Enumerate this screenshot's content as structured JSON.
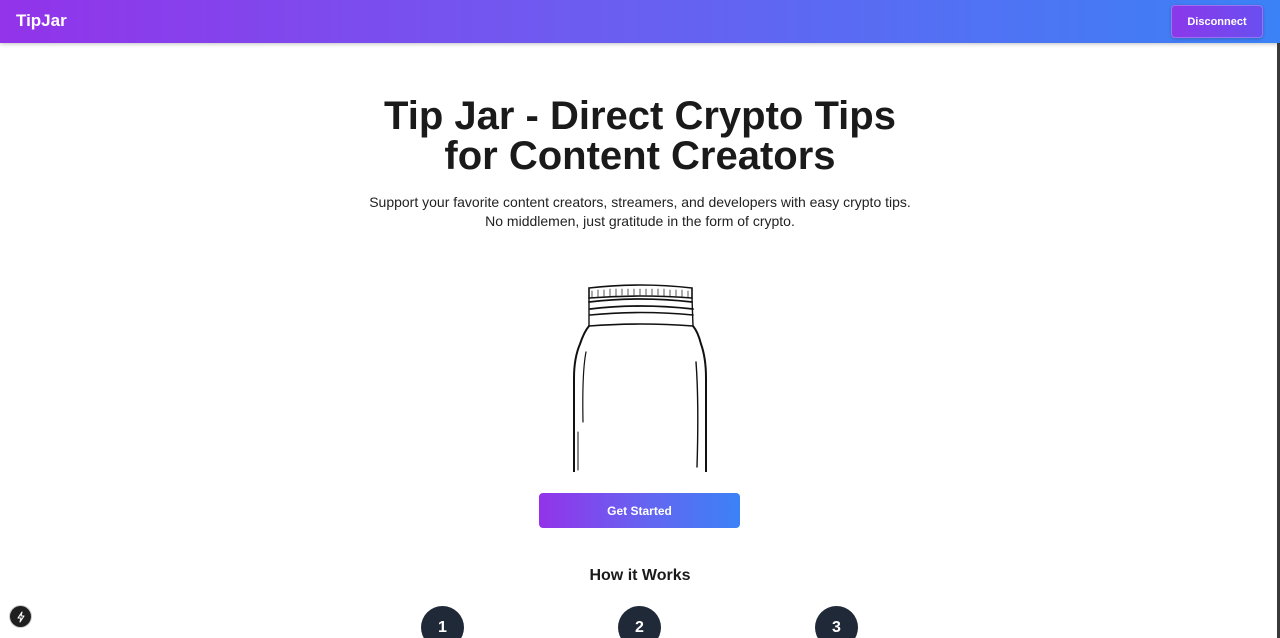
{
  "header": {
    "brand": "TipJar",
    "disconnect_label": "Disconnect",
    "gradient_start": "#9333ea",
    "gradient_end": "#3b82f6"
  },
  "hero": {
    "title_line1": "Tip Jar - Direct Crypto Tips",
    "title_line2": "for Content Creators",
    "subtitle": "Support your favorite content creators, streamers, and developers with easy crypto tips. No middlemen, just gratitude in the form of crypto.",
    "image_icon": "mason-jar-illustration",
    "cta_label": "Get Started"
  },
  "how_it_works": {
    "title": "How it Works",
    "steps": [
      {
        "number": "1"
      },
      {
        "number": "2"
      },
      {
        "number": "3"
      }
    ]
  },
  "dev_indicator": {
    "icon": "lightning-icon"
  }
}
